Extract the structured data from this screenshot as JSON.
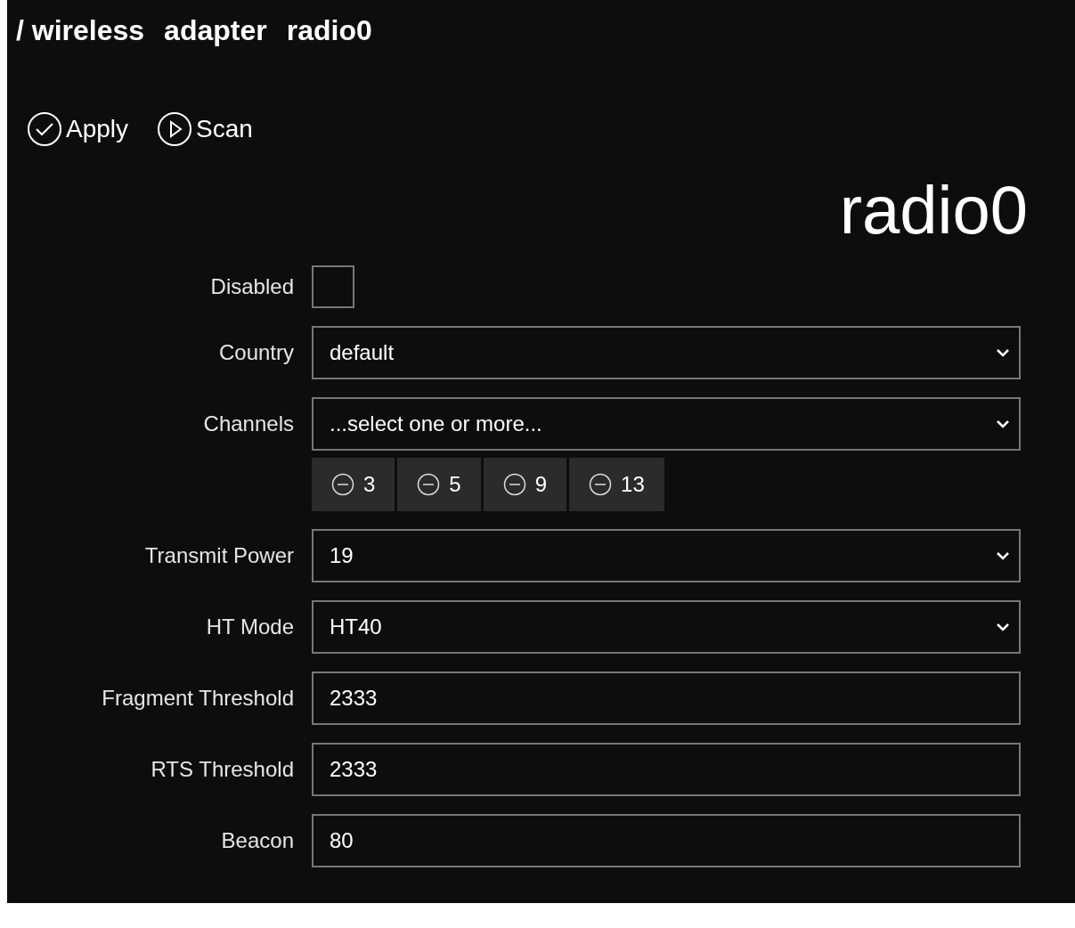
{
  "breadcrumb": [
    "/ wireless",
    "adapter",
    "radio0"
  ],
  "actions": [
    {
      "kind": "apply",
      "label": "Apply"
    },
    {
      "kind": "scan",
      "label": "Scan"
    }
  ],
  "heading": "radio0",
  "fields": [
    {
      "kind": "checkbox",
      "label": "Disabled",
      "checked": false
    },
    {
      "kind": "select",
      "label": "Country",
      "value": "default"
    },
    {
      "kind": "multiselect",
      "label": "Channels",
      "placeholder": "...select one or more...",
      "chips": [
        "3",
        "5",
        "9",
        "13"
      ]
    },
    {
      "kind": "select",
      "label": "Transmit Power",
      "value": "19"
    },
    {
      "kind": "select",
      "label": "HT Mode",
      "value": "HT40"
    },
    {
      "kind": "input",
      "label": "Fragment Threshold",
      "value": "2333"
    },
    {
      "kind": "input",
      "label": "RTS Threshold",
      "value": "2333"
    },
    {
      "kind": "input",
      "label": "Beacon",
      "value": "80"
    }
  ]
}
